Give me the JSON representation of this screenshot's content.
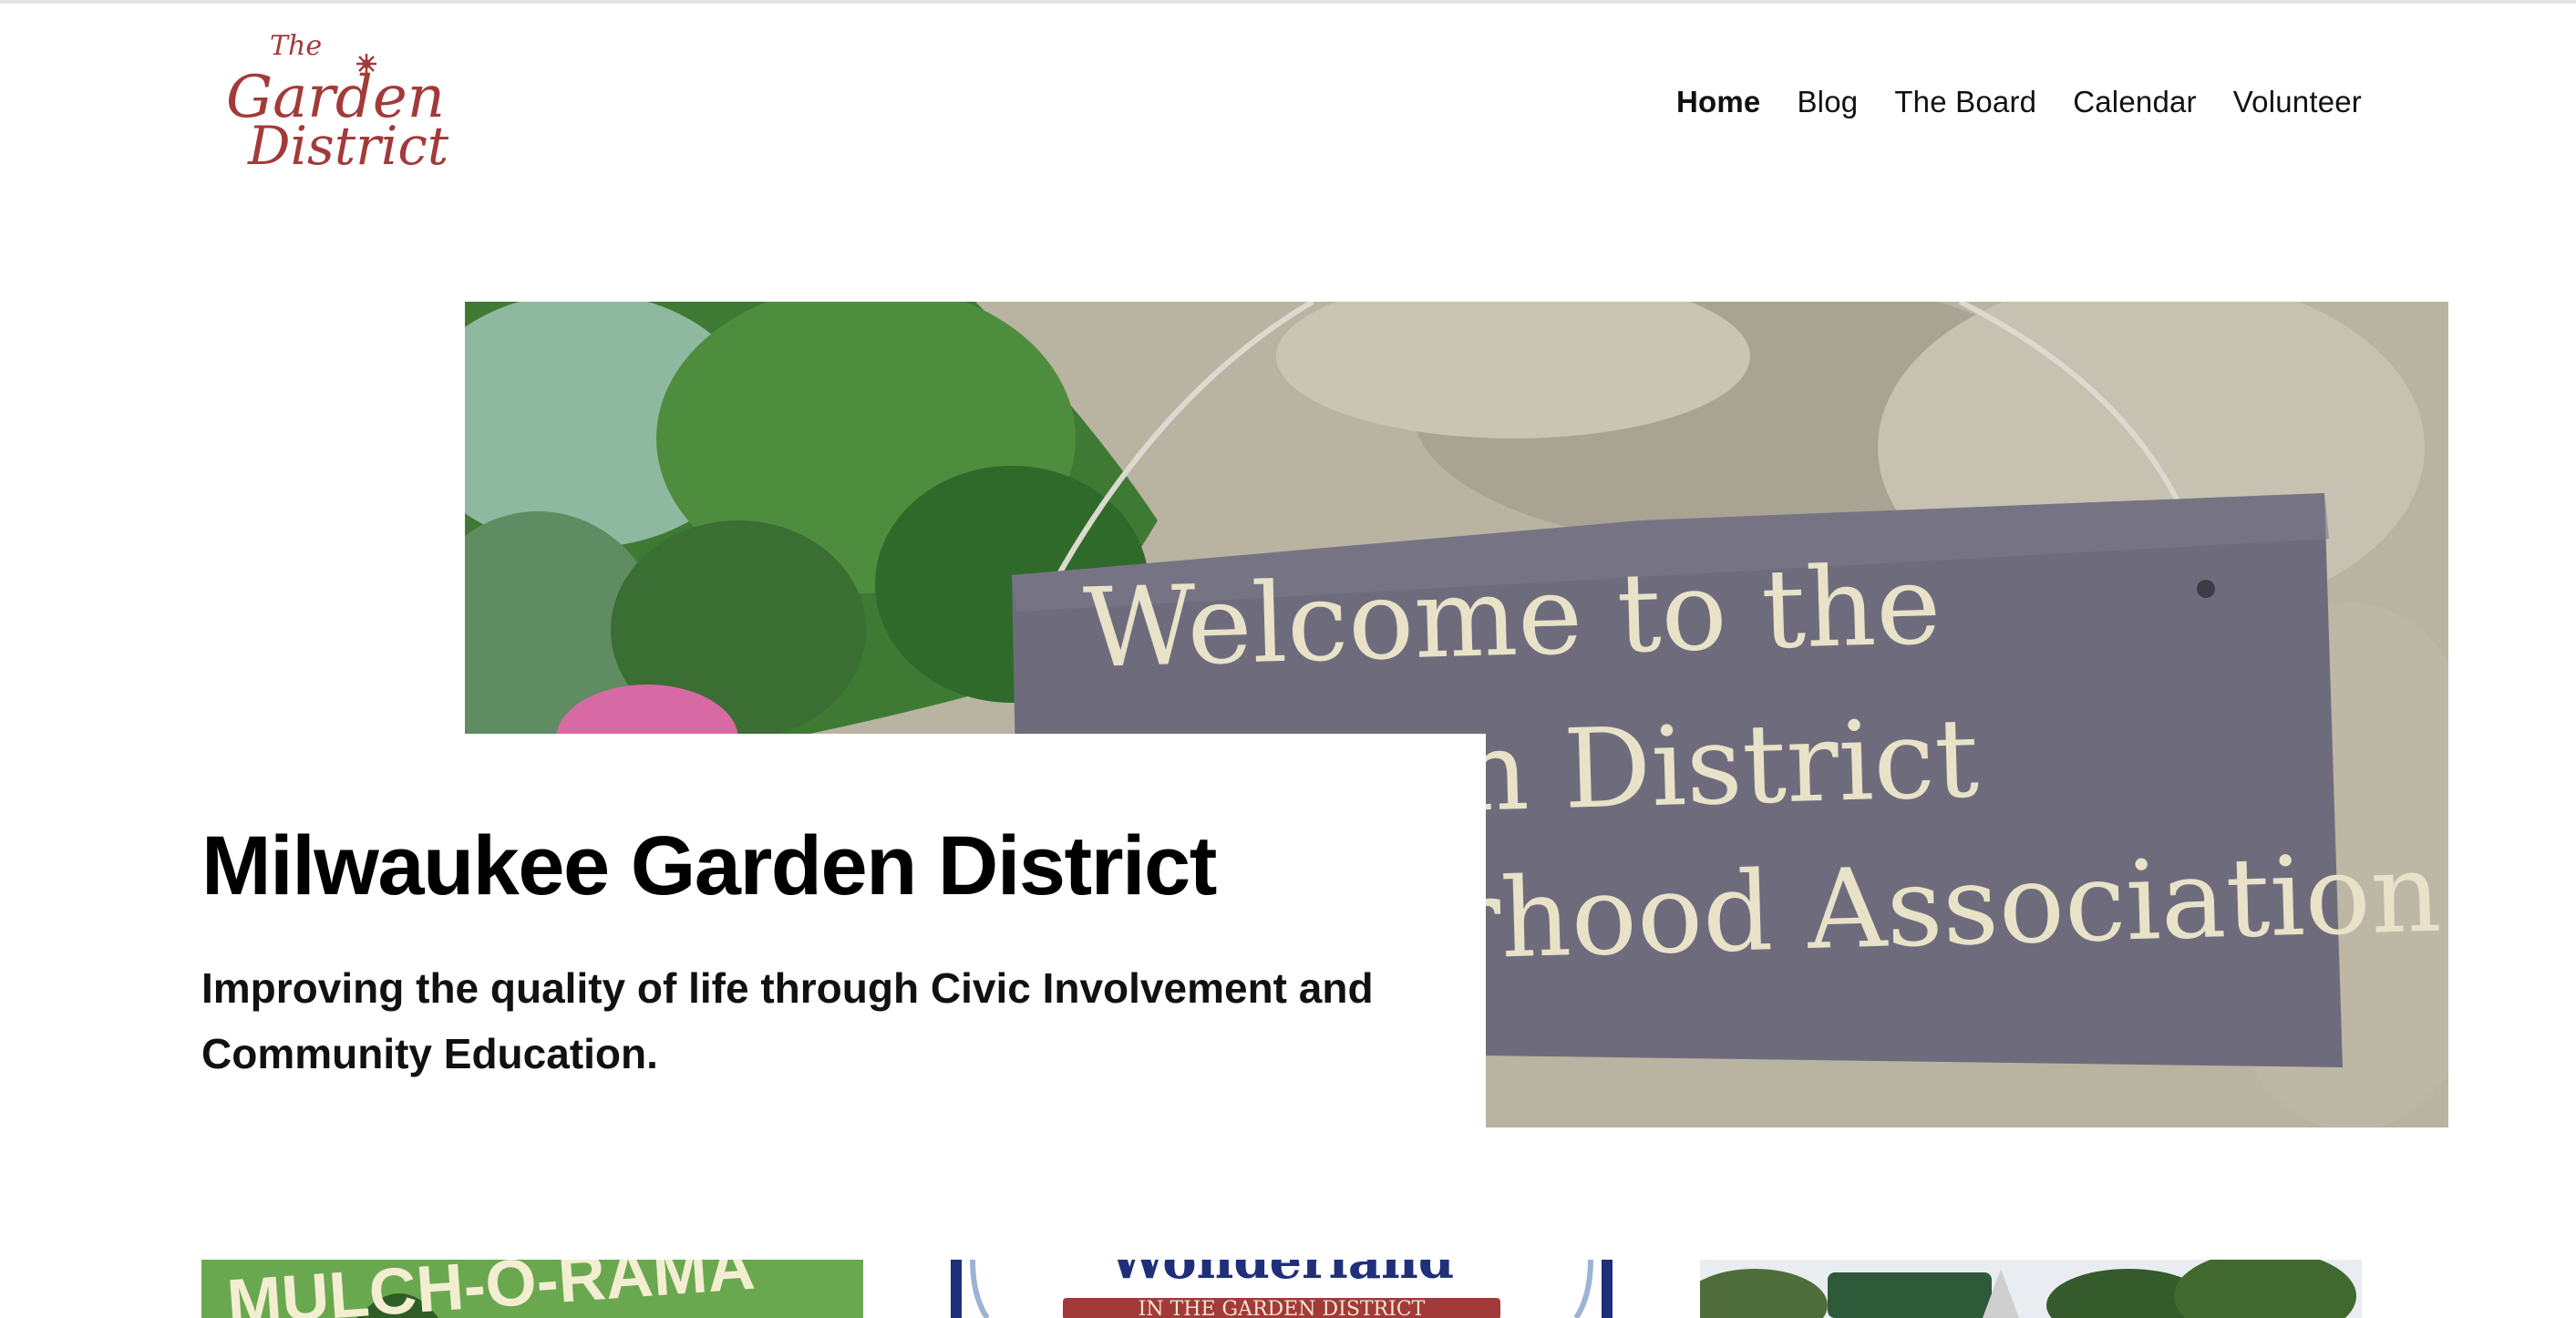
{
  "logo": {
    "line1": "The",
    "line2": "Garden",
    "line3": "District"
  },
  "nav": {
    "items": [
      {
        "label": "Home",
        "active": true
      },
      {
        "label": "Blog",
        "active": false
      },
      {
        "label": "The Board",
        "active": false
      },
      {
        "label": "Calendar",
        "active": false
      },
      {
        "label": "Volunteer",
        "active": false
      }
    ]
  },
  "hero": {
    "title": "Milwaukee Garden District",
    "subtitle": "Improving the quality of life through Civic Involvement and Community Education.",
    "image": {
      "sign_line1": "Welcome to the",
      "sign_line2": "en District",
      "sign_line3": "rhood Association"
    }
  },
  "cards": {
    "card1": {
      "image_text": "MULCH-O-RAMA"
    },
    "card2": {
      "image_text_top": "Wonderland",
      "image_text_band": "IN THE GARDEN DISTRICT"
    },
    "card3": {}
  },
  "colors": {
    "logo": "#a33a3a",
    "accent_green": "#6aa84f",
    "accent_red": "#a33a3a",
    "navy": "#1f2f7a"
  }
}
